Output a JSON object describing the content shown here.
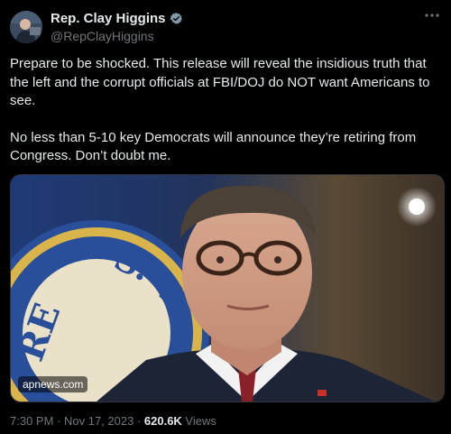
{
  "author": {
    "display_name": "Rep. Clay Higgins",
    "handle": "@RepClayHiggins",
    "verified": true,
    "avatar_icon": "profile-photo"
  },
  "tweet": {
    "paragraphs": [
      "Prepare to be shocked. This release will reveal the insidious truth that the left and the corrupt officials at FBI/DOJ do NOT want Americans to see.",
      "No less than 5-10 key Democrats will announce they’re retiring from Congress. Don’t doubt me."
    ],
    "media": {
      "source_label": "apnews.com"
    },
    "time": "7:30 PM",
    "separator": " · ",
    "date": "Nov 17, 2023",
    "views_count": "620.6K",
    "views_label": " Views"
  },
  "colors": {
    "background": "#000000",
    "text": "#e7e9ea",
    "secondary": "#71767b",
    "verified": "#829aab"
  },
  "icons": {
    "more": "more-horizontal-icon",
    "verified": "verified-badge-icon"
  }
}
